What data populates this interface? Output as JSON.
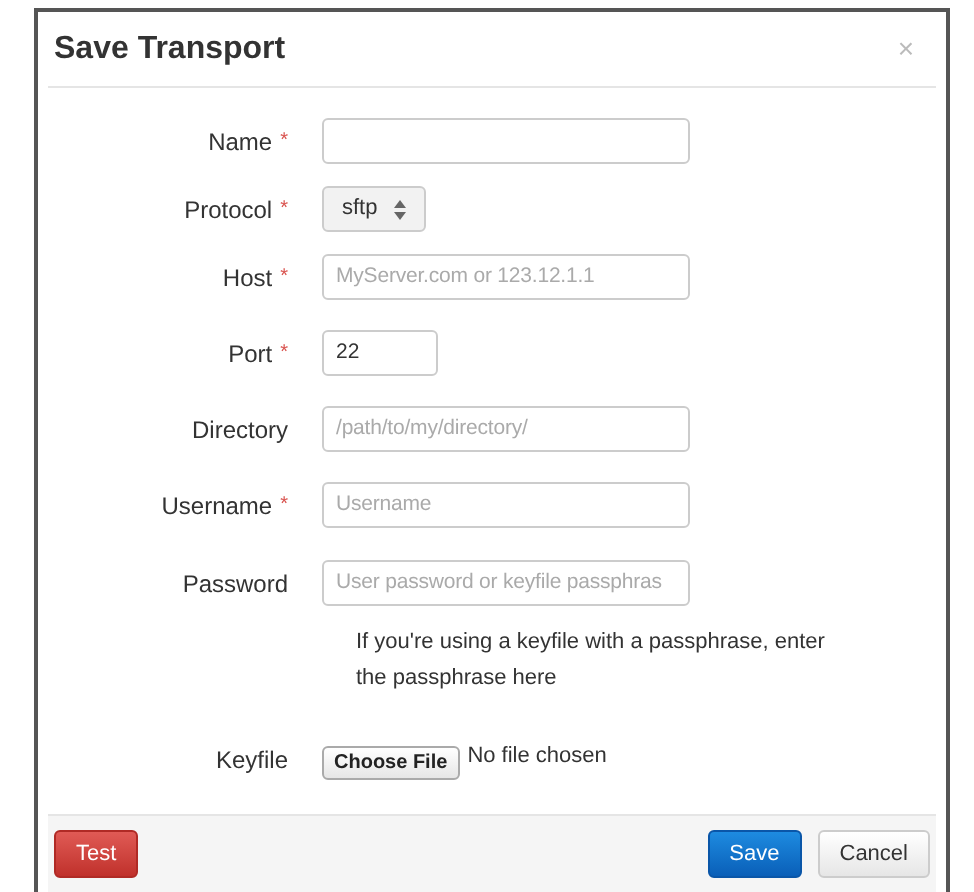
{
  "dialog": {
    "title": "Save Transport",
    "close": "×"
  },
  "fields": [
    {
      "kind": "text",
      "label": "Name",
      "required": true
    },
    {
      "kind": "select",
      "label": "Protocol",
      "required": true,
      "value": "sftp"
    },
    {
      "kind": "text",
      "label": "Host",
      "required": true,
      "placeholder": "MyServer.com or 123.12.1.1"
    },
    {
      "kind": "number",
      "label": "Port",
      "required": true,
      "value": "22"
    },
    {
      "kind": "text",
      "label": "Directory",
      "required": false,
      "placeholder": "/path/to/my/directory/"
    },
    {
      "kind": "text",
      "label": "Username",
      "required": true,
      "placeholder": "Username"
    },
    {
      "kind": "text",
      "label": "Password",
      "required": false,
      "placeholder": "User password or keyfile passphras",
      "help": "If you're using a keyfile with a passphrase, enter the passphrase here"
    },
    {
      "kind": "file",
      "label": "Keyfile",
      "required": false,
      "button": "Choose File",
      "status": "No file chosen"
    }
  ],
  "required_mark": "*",
  "footer": {
    "test": "Test",
    "save": "Save",
    "cancel": "Cancel"
  }
}
